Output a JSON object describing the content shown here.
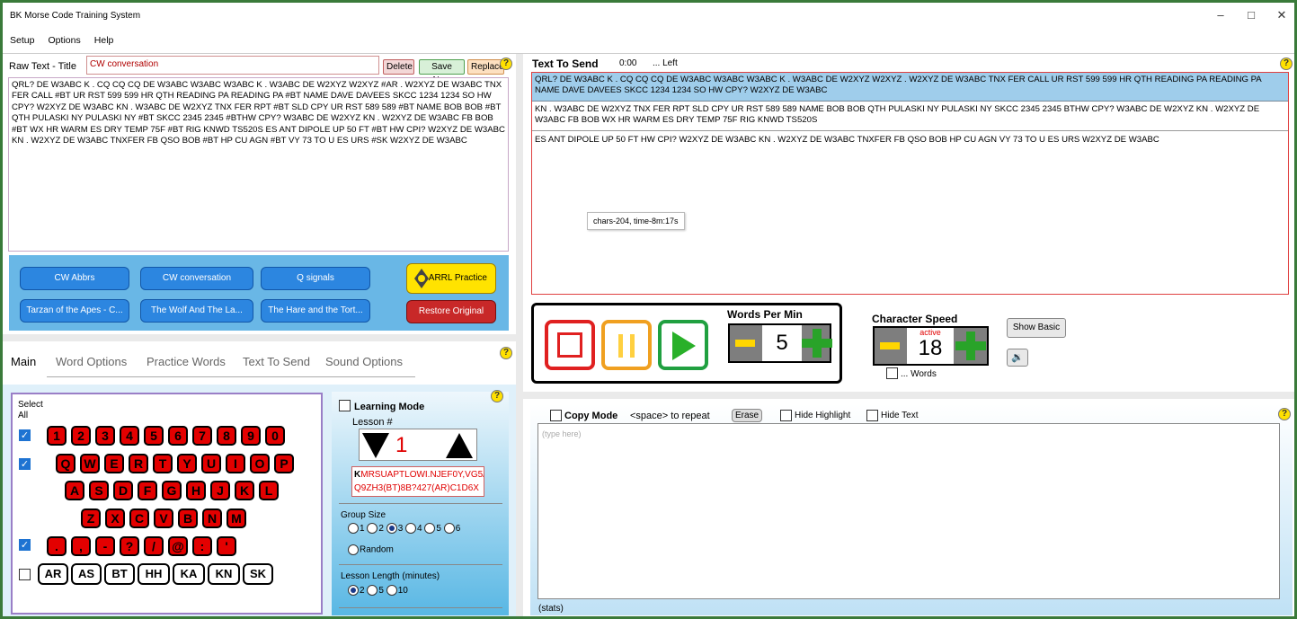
{
  "window": {
    "title": "BK Morse Code Training System",
    "controls": [
      "–",
      "□",
      "✕"
    ]
  },
  "menu": [
    "Setup",
    "Options",
    "Help"
  ],
  "raw_text": {
    "label": "Raw Text - Title",
    "title_value": "CW conversation",
    "delete": "Delete",
    "save_new": "Save New",
    "replace": "Replace",
    "body": "QRL? DE W3ABC K . CQ CQ CQ DE W3ABC W3ABC W3ABC K . W3ABC DE W2XYZ W2XYZ #AR . W2XYZ DE W3ABC TNX FER CALL #BT UR RST 599 599 HR QTH READING PA READING PA #BT NAME DAVE DAVEES SKCC 1234 1234 SO HW CPY? W2XYZ DE W3ABC KN . W3ABC DE W2XYZ TNX FER RPT #BT SLD CPY UR RST 589 589 #BT NAME BOB BOB #BT QTH PULASKI NY PULASKI NY #BT SKCC 2345 2345 #BTHW CPY? W3ABC DE W2XYZ KN . W2XYZ DE W3ABC FB BOB #BT WX HR WARM ES DRY TEMP 75F #BT RIG KNWD TS520S ES ANT DIPOLE UP 50 FT #BT HW CPI? W2XYZ DE W3ABC KN . W2XYZ DE W3ABC TNXFER FB QSO BOB #BT HP CU AGN #BT VY 73 TO U ES URS #SK W2XYZ DE W3ABC"
  },
  "library_buttons": [
    "CW Abbrs",
    "CW conversation",
    "Q signals",
    "Tarzan of the Apes - C...",
    "The Wolf And The La...",
    "The Hare and the Tort..."
  ],
  "arrl_practice": "ARRL Practice",
  "restore_original": "Restore Original",
  "tabs": [
    "Main",
    "Word Options",
    "Practice Words",
    "Text To Send",
    "Sound Options"
  ],
  "select_all_label": "Select\nAll",
  "keys": {
    "row1": [
      "1",
      "2",
      "3",
      "4",
      "5",
      "6",
      "7",
      "8",
      "9",
      "0"
    ],
    "row2": [
      "Q",
      "W",
      "E",
      "R",
      "T",
      "Y",
      "U",
      "I",
      "O",
      "P"
    ],
    "row3": [
      "A",
      "S",
      "D",
      "F",
      "G",
      "H",
      "J",
      "K",
      "L"
    ],
    "row4": [
      "Z",
      "X",
      "C",
      "V",
      "B",
      "N",
      "M"
    ],
    "row5": [
      ".",
      ",",
      "-",
      "?",
      "/",
      "@",
      ":",
      "'"
    ],
    "prosigns": [
      "AR",
      "AS",
      "BT",
      "HH",
      "KA",
      "KN",
      "SK"
    ]
  },
  "lesson": {
    "learning_mode": "Learning Mode",
    "lesson_label": "Lesson #",
    "lesson_value": "1",
    "char_first": "K",
    "chars_rest": "MRSUAPTLOWI.NJEF0Y,VG5/",
    "chars_line2": "Q9ZH3(BT)8B?427(AR)C1D6X",
    "group_size_label": "Group Size",
    "group_sizes": [
      "1",
      "2",
      "3",
      "4",
      "5",
      "6"
    ],
    "group_selected": "3",
    "random": "Random",
    "length_label": "Lesson Length (minutes)",
    "lengths": [
      "2",
      "5",
      "10"
    ],
    "length_selected": "2"
  },
  "send": {
    "label": "Text To Send",
    "time": "0:00",
    "left": "... Left",
    "line1": "QRL? DE W3ABC K . CQ CQ CQ DE W3ABC W3ABC W3ABC K . W3ABC DE W2XYZ W2XYZ . W2XYZ DE W3ABC TNX FER CALL UR RST 599 599 HR QTH READING PA READING PA NAME DAVE DAVEES SKCC 1234 1234 SO HW CPY? W2XYZ DE W3ABC",
    "line2": "KN . W3ABC DE W2XYZ TNX FER RPT SLD CPY UR RST 589 589 NAME BOB BOB QTH PULASKI NY PULASKI NY SKCC 2345 2345 BTHW CPY? W3ABC DE W2XYZ KN . W2XYZ DE W3ABC FB BOB WX HR WARM ES DRY TEMP 75F RIG KNWD TS520S",
    "line3": "ES ANT DIPOLE UP 50 FT HW CPI? W2XYZ DE W3ABC KN . W2XYZ DE W3ABC TNXFER FB QSO BOB HP CU AGN VY 73 TO U ES URS W2XYZ DE W3ABC",
    "tooltip": "chars-204, time-8m:17s"
  },
  "controls": {
    "wpm_label": "Words Per Min",
    "wpm_value": "5",
    "char_speed_label": "Character Speed",
    "char_active": "active",
    "char_value": "18",
    "words_label": "... Words",
    "show_basic": "Show Basic",
    "sound_icon": "🔉"
  },
  "copy": {
    "copy_mode": "Copy Mode",
    "space_hint": "<space> to repeat",
    "erase": "Erase",
    "hide_highlight": "Hide Highlight",
    "hide_text": "Hide Text",
    "placeholder": "(type here)",
    "stats": "(stats)"
  },
  "colors": {
    "accent_blue": "#2c86e0",
    "key_red": "#e30000",
    "highlight": "#9fcdeb"
  }
}
